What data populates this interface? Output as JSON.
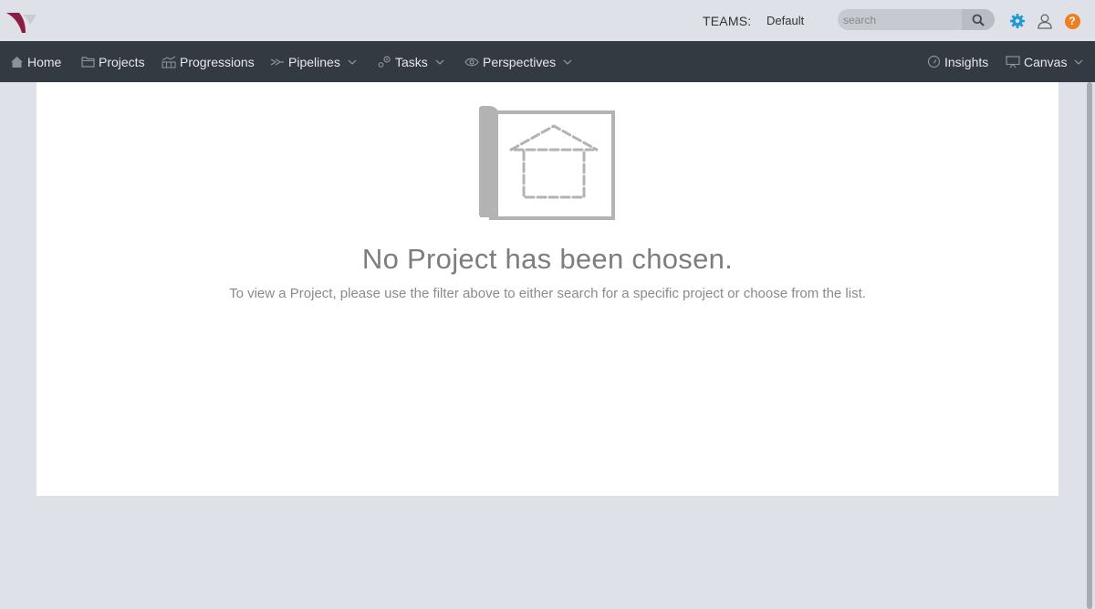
{
  "header": {
    "teams_label": "TEAMS:",
    "teams_value": "Default",
    "search_placeholder": "search"
  },
  "nav": {
    "home": "Home",
    "projects": "Projects",
    "progressions": "Progressions",
    "pipelines": "Pipelines",
    "tasks": "Tasks",
    "perspectives": "Perspectives",
    "insights": "Insights",
    "canvas": "Canvas"
  },
  "empty_state": {
    "title": "No Project has been chosen.",
    "subtitle": "To view a Project, please use the filter above to either search for a specific project or choose from the list."
  },
  "colors": {
    "brand": "#8b1d3f",
    "navbar": "#343a42",
    "background": "#dee1e8",
    "gear_accent": "#1f9ad6",
    "help_accent": "#f07d1e"
  },
  "icons": [
    "logo",
    "search-icon",
    "gear-icon",
    "user-icon",
    "help-icon",
    "home-icon",
    "folder-icon",
    "progressions-icon",
    "pipelines-icon",
    "tasks-icon",
    "eye-icon",
    "gauge-icon",
    "monitor-icon",
    "chevron-down-icon",
    "blueprint-house-icon"
  ]
}
